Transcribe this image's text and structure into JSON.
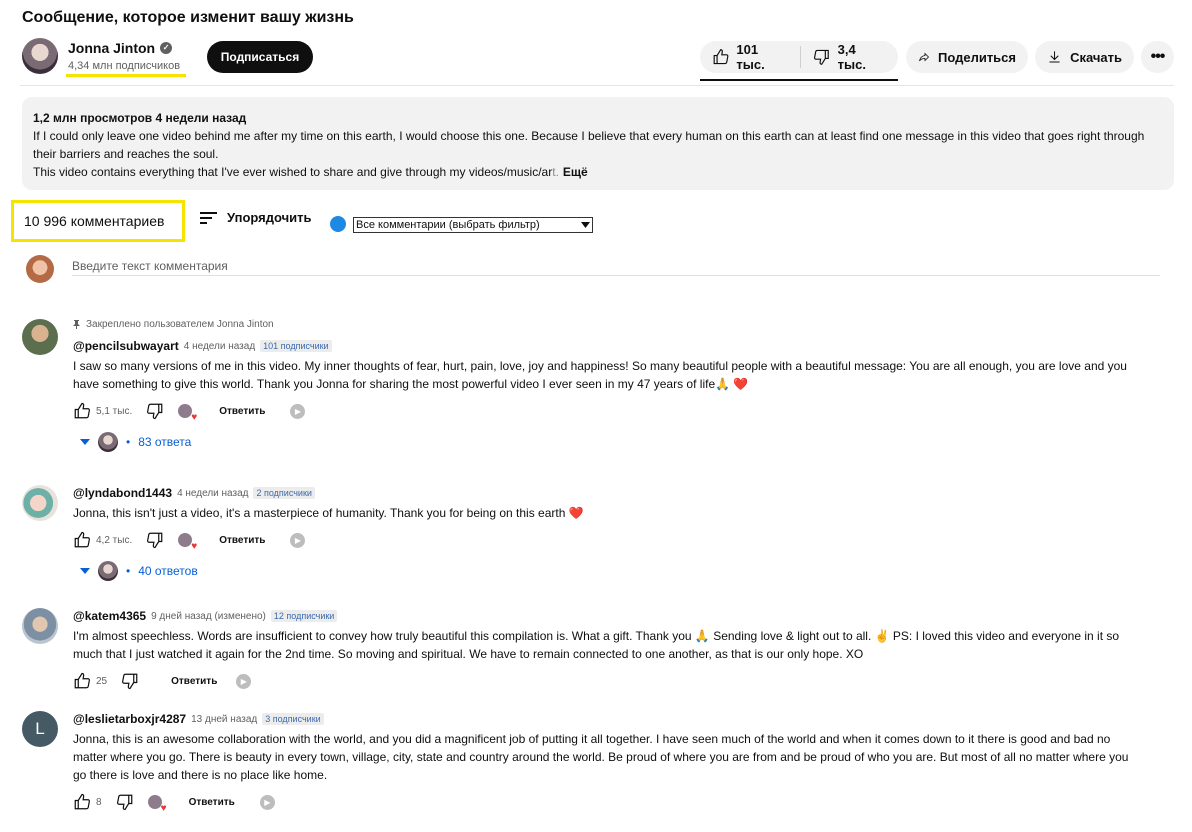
{
  "video": {
    "title": "Сообщение, которое изменит вашу жизнь"
  },
  "channel": {
    "name": "Jonna Jinton",
    "verified_glyph": "✓",
    "subscribers": "4,34 млн подписчиков",
    "subscribe_label": "Подписаться",
    "avatar_icon": "channel-avatar"
  },
  "actions": {
    "likes": "101 тыс.",
    "dislikes": "3,4 тыс.",
    "share": "Поделиться",
    "download": "Скачать",
    "more": "•••"
  },
  "description": {
    "meta": "1,2 млн просмотров  4 недели назад",
    "line1": "If I could only leave one video behind me after my time on this earth, I would choose this one. Because I believe that every human on this earth can at least find one message in this video that goes right through their barriers and reaches the soul.",
    "line2": "This video contains everything that I've ever wished to share and give through my videos/music/ar",
    "line2_fade": "t.",
    "more": "Ещё"
  },
  "comments_header": {
    "count": "10 996 комментариев",
    "sort_label": "Упорядочить",
    "filter_value": "Все комментарии (выбрать фильтр)",
    "input_placeholder": "Введите текст комментария"
  },
  "comments": [
    {
      "pinned": "Закреплено пользователем Jonna Jinton",
      "handle": "@pencilsubwayart",
      "time": "4 недели назад",
      "subs": "101 подписчики",
      "text": "I saw so many versions of me in this video. My inner thoughts of fear, hurt, pain, love, joy and happiness! So many beautiful people with a beautiful message: You are all enough, you are love and you have something to give this world. Thank you Jonna for sharing the most powerful video I ever seen in my 47 years of life🙏 ❤️",
      "likes": "5,1 тыс.",
      "reply": "Ответить",
      "replies": "83 ответа"
    },
    {
      "handle": "@lyndabond1443",
      "time": "4 недели назад",
      "subs": "2 подписчики",
      "text": "Jonna, this isn't just a video, it's a masterpiece of humanity. Thank you for being on this earth ❤️",
      "likes": "4,2 тыс.",
      "reply": "Ответить",
      "replies": "40 ответов"
    },
    {
      "handle": "@katem4365",
      "time": "9 дней назад (изменено)",
      "subs": "12 подписчики",
      "text": "I'm almost speechless. Words are insufficient to convey how truly beautiful this compilation is. What a gift. Thank you 🙏 Sending love & light out to all. ✌️ PS: I loved this video and everyone in it so much that I just watched it again for the 2nd time. So moving and spiritual. We have to remain connected to one another, as that is our only hope. XO",
      "likes": "25",
      "reply": "Ответить"
    },
    {
      "handle": "@leslietarboxjr4287",
      "time": "13 дней назад",
      "subs": "3 подписчики",
      "avatar_letter": "L",
      "text": "Jonna, this is an awesome collaboration with the world, and you did a magnificent job of putting it all together. I have seen much of the world and when it comes down to it there is good and bad no matter where you go. There is beauty in every town, village, city, state and country around the world. Be proud of where you are from and be proud of who you are. But most of all no matter where you go there is love and there is no place like home.",
      "likes": "8",
      "reply": "Ответить"
    }
  ],
  "colors": {
    "accent_highlight": "#f5e400",
    "link_blue": "#065fd4",
    "heart_red": "#e53935"
  }
}
